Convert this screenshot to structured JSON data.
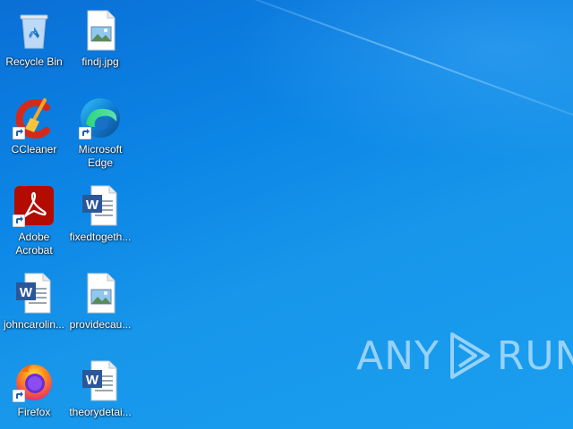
{
  "desktop": {
    "icons": [
      {
        "label": "Recycle Bin",
        "icon": "recycle-bin-icon"
      },
      {
        "label": "findj.jpg",
        "icon": "image-file-icon"
      },
      {
        "label": "CCleaner",
        "icon": "ccleaner-icon"
      },
      {
        "label": "Microsoft Edge",
        "icon": "edge-icon"
      },
      {
        "label": "Adobe Acrobat",
        "icon": "acrobat-icon"
      },
      {
        "label": "fixedtogeth...",
        "icon": "word-document-icon"
      },
      {
        "label": "johncarolin...",
        "icon": "word-document-icon"
      },
      {
        "label": "providecau...",
        "icon": "image-file-icon"
      },
      {
        "label": "Firefox",
        "icon": "firefox-icon"
      },
      {
        "label": "theorydetai...",
        "icon": "word-document-icon"
      }
    ]
  },
  "watermark": {
    "left": "ANY",
    "right": "RUN"
  },
  "colors": {
    "desktop_blue": "#0c86e6",
    "acrobat_red": "#b30b00",
    "word_blue": "#2b579a"
  }
}
